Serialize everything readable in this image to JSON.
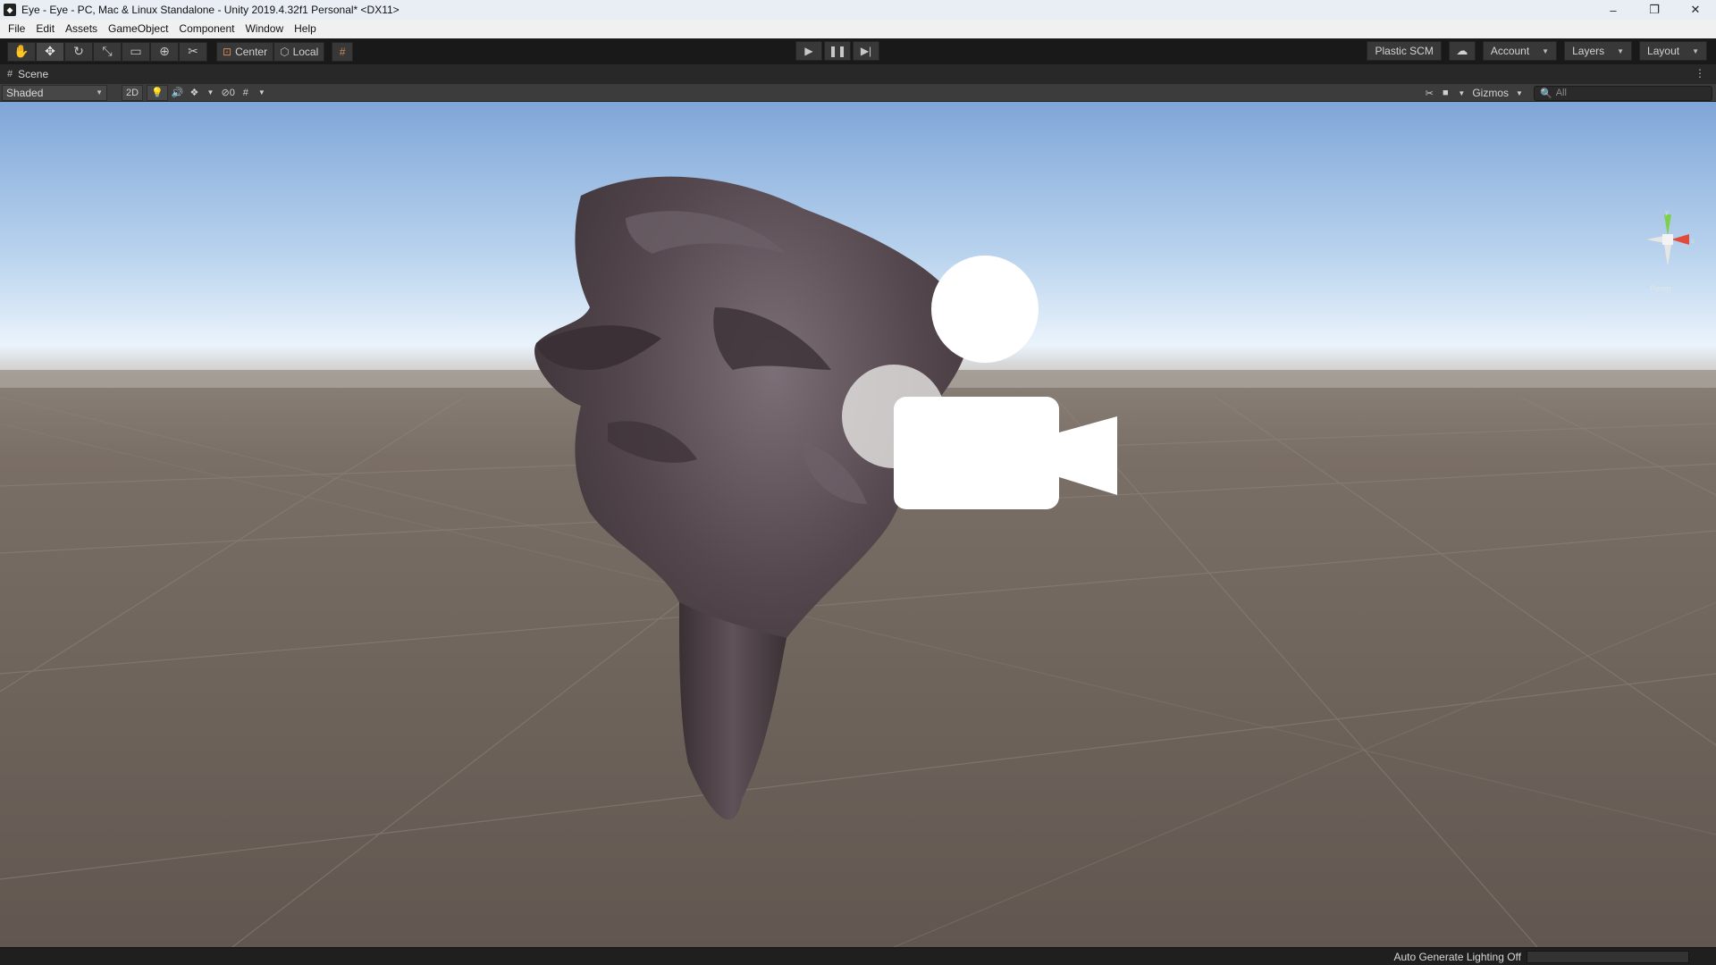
{
  "window": {
    "title": "Eye - Eye - PC, Mac & Linux Standalone - Unity 2019.4.32f1 Personal* <DX11>",
    "controls": [
      "–",
      "❐",
      "✕"
    ]
  },
  "menu": [
    "File",
    "Edit",
    "Assets",
    "GameObject",
    "Component",
    "Window",
    "Help"
  ],
  "toolbar": {
    "tools": [
      {
        "name": "hand-tool",
        "glyph": "✋"
      },
      {
        "name": "move-tool",
        "glyph": "✥"
      },
      {
        "name": "rotate-tool",
        "glyph": "↻"
      },
      {
        "name": "scale-tool",
        "glyph": "⤡"
      },
      {
        "name": "rect-tool",
        "glyph": "▭"
      },
      {
        "name": "transform-tool",
        "glyph": "⊕"
      },
      {
        "name": "custom-tool",
        "glyph": "✂"
      }
    ],
    "pivot_label": "Center",
    "rotation_label": "Local",
    "plastic_label": "Plastic SCM",
    "account_label": "Account",
    "layers_label": "Layers",
    "layout_label": "Layout"
  },
  "scene": {
    "tab_label": "Scene",
    "shading_mode": "Shaded",
    "mode_2d": "2D",
    "hidden_count": "0",
    "gizmos_label": "Gizmos",
    "search_placeholder": "All",
    "persp_label": "Persp",
    "axis_y": "y",
    "axis_x": "x"
  },
  "status": {
    "text": "Auto Generate Lighting Off"
  }
}
